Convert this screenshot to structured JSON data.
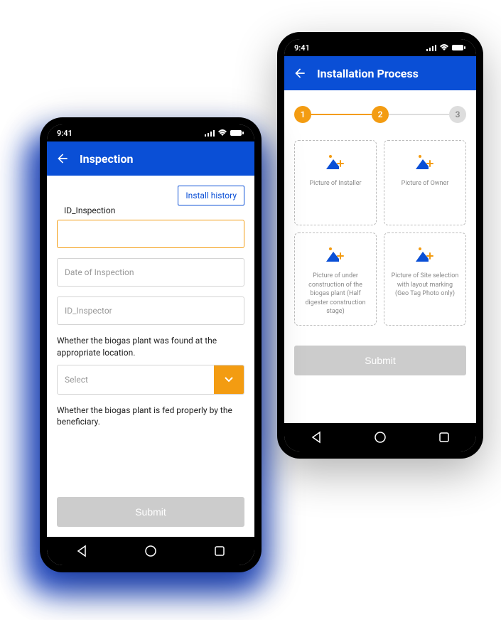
{
  "statusbar": {
    "time": "9:41"
  },
  "left": {
    "title": "Inspection",
    "install_history": "Install history",
    "id_inspection_label": "ID_Inspection",
    "id_inspection_value": "",
    "date_placeholder": "Date of Inspection",
    "inspector_placeholder": "ID_Inspector",
    "question1": "Whether the biogas plant was found at the appropriate location.",
    "select_placeholder": "Select",
    "question2": "Whether the biogas plant is fed properly by the beneficiary.",
    "submit": "Submit"
  },
  "right": {
    "title": "Installation Process",
    "steps": [
      "1",
      "2",
      "3"
    ],
    "cards": [
      "Picture of Installer",
      "Picture of Owner",
      "Picture of under construction of the biogas plant (Half digester construction stage)",
      "Picture of Site selection with layout marking (Geo Tag Photo only)"
    ],
    "submit": "Submit"
  },
  "colors": {
    "primary": "#0a4fd6",
    "accent": "#f39c12"
  }
}
